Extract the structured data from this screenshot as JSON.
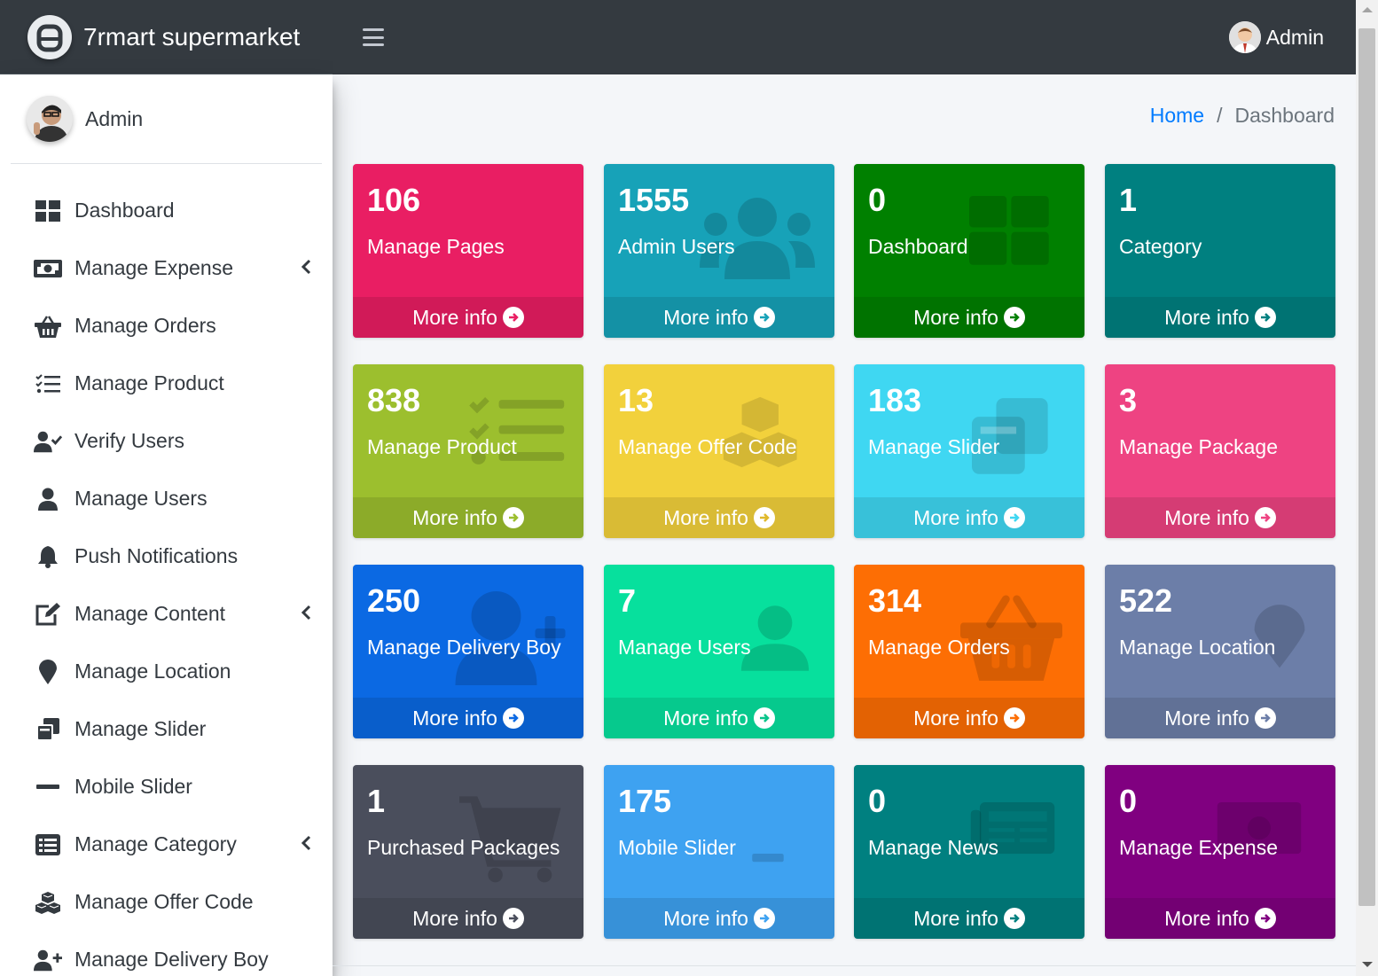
{
  "brand": {
    "name": "7rmart supermarket"
  },
  "sidebar": {
    "user": "Admin",
    "items": [
      {
        "label": "Dashboard",
        "icon": "dashboard-icon",
        "caret": false
      },
      {
        "label": "Manage Expense",
        "icon": "money-icon",
        "caret": true
      },
      {
        "label": "Manage Orders",
        "icon": "basket-icon",
        "caret": false
      },
      {
        "label": "Manage Product",
        "icon": "tasks-icon",
        "caret": false
      },
      {
        "label": "Verify Users",
        "icon": "user-check-icon",
        "caret": false
      },
      {
        "label": "Manage Users",
        "icon": "user-icon",
        "caret": false
      },
      {
        "label": "Push Notifications",
        "icon": "bell-icon",
        "caret": false
      },
      {
        "label": "Manage Content",
        "icon": "edit-icon",
        "caret": true
      },
      {
        "label": "Manage Location",
        "icon": "map-marker-icon",
        "caret": false
      },
      {
        "label": "Manage Slider",
        "icon": "clone-icon",
        "caret": false
      },
      {
        "label": "Mobile Slider",
        "icon": "minus-icon",
        "caret": false
      },
      {
        "label": "Manage Category",
        "icon": "list-alt-icon",
        "caret": true
      },
      {
        "label": "Manage Offer Code",
        "icon": "cubes-icon",
        "caret": false
      },
      {
        "label": "Manage Delivery Boy",
        "icon": "user-plus-icon",
        "caret": false
      }
    ]
  },
  "topbar": {
    "user": "Admin"
  },
  "breadcrumb": {
    "home": "Home",
    "separator": "/",
    "current": "Dashboard"
  },
  "cards": [
    {
      "value": "106",
      "title": "Manage Pages",
      "footer": "More info",
      "color": "#e91e63",
      "icon": "none"
    },
    {
      "value": "1555",
      "title": "Admin Users",
      "footer": "More info",
      "color": "#17a2b8",
      "icon": "users-icon"
    },
    {
      "value": "0",
      "title": "Dashboard",
      "footer": "More info",
      "color": "#008000",
      "icon": "dashboard-icon"
    },
    {
      "value": "1",
      "title": "Category",
      "footer": "More info",
      "color": "#008080",
      "icon": "none"
    },
    {
      "value": "838",
      "title": "Manage Product",
      "footer": "More info",
      "color": "#9cbf2e",
      "icon": "tasks-icon"
    },
    {
      "value": "13",
      "title": "Manage Offer Code",
      "footer": "More info",
      "color": "#f2d13c",
      "icon": "cubes-icon"
    },
    {
      "value": "183",
      "title": "Manage Slider",
      "footer": "More info",
      "color": "#3fd7f2",
      "icon": "clone-icon"
    },
    {
      "value": "3",
      "title": "Manage Package",
      "footer": "More info",
      "color": "#ee4382",
      "icon": "none"
    },
    {
      "value": "250",
      "title": "Manage Delivery Boy",
      "footer": "More info",
      "color": "#0b69e3",
      "icon": "user-plus-icon"
    },
    {
      "value": "7",
      "title": "Manage Users",
      "footer": "More info",
      "color": "#07e09d",
      "icon": "user-icon"
    },
    {
      "value": "314",
      "title": "Manage Orders",
      "footer": "More info",
      "color": "#fd6e04",
      "icon": "basket-icon"
    },
    {
      "value": "522",
      "title": "Manage Location",
      "footer": "More info",
      "color": "#6c7ea8",
      "icon": "map-marker-icon"
    },
    {
      "value": "1",
      "title": "Purchased Packages",
      "footer": "More info",
      "color": "#4a4e5c",
      "icon": "cart-icon"
    },
    {
      "value": "175",
      "title": "Mobile Slider",
      "footer": "More info",
      "color": "#3ea2f1",
      "icon": "minus-icon"
    },
    {
      "value": "0",
      "title": "Manage News",
      "footer": "More info",
      "color": "#008080",
      "icon": "newspaper-icon"
    },
    {
      "value": "0",
      "title": "Manage Expense",
      "footer": "More info",
      "color": "#800080",
      "icon": "money-icon"
    }
  ]
}
